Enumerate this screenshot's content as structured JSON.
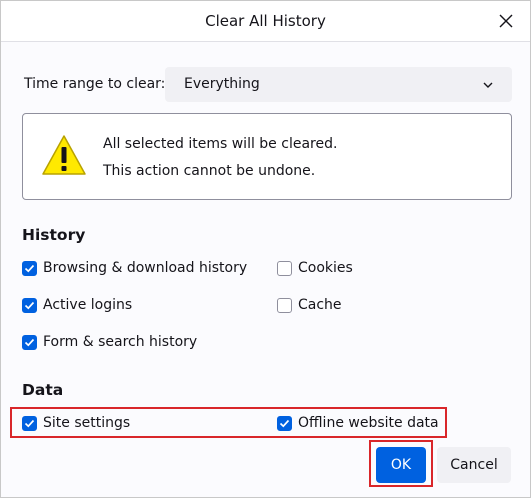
{
  "dialog": {
    "title": "Clear All History",
    "close_icon": "close-icon"
  },
  "time_range": {
    "label": "Time range to clear:",
    "selected": "Everything"
  },
  "warning": {
    "icon": "warning-icon",
    "line1": "All selected items will be cleared.",
    "line2": "This action cannot be undone."
  },
  "history": {
    "heading": "History",
    "items": [
      {
        "label": "Browsing & download history",
        "checked": true
      },
      {
        "label": "Cookies",
        "checked": false
      },
      {
        "label": "Active logins",
        "checked": true
      },
      {
        "label": "Cache",
        "checked": false
      },
      {
        "label": "Form & search history",
        "checked": true
      }
    ]
  },
  "data_section": {
    "heading": "Data",
    "items": [
      {
        "label": "Site settings",
        "checked": true
      },
      {
        "label": "Offline website data",
        "checked": true
      }
    ]
  },
  "buttons": {
    "ok": "OK",
    "cancel": "Cancel"
  },
  "colors": {
    "accent": "#0061e0",
    "highlight": "#d9262a",
    "warning": "#ffe900"
  }
}
